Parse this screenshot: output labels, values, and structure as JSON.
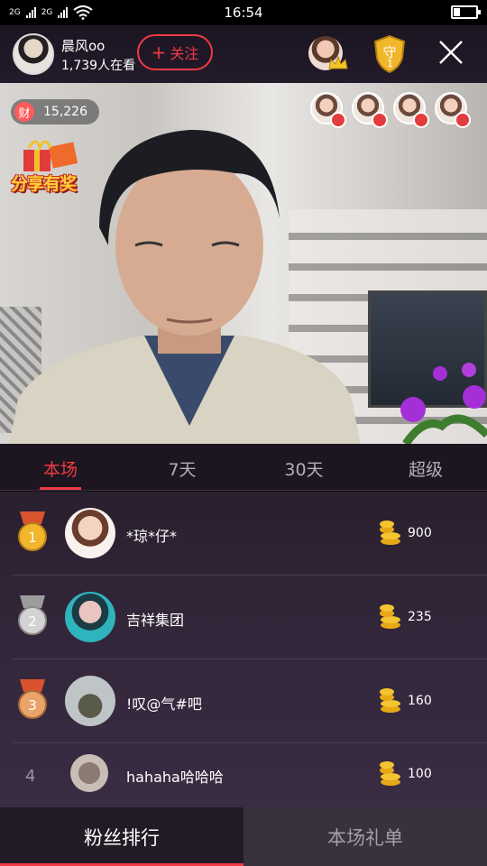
{
  "status_bar": {
    "signal1_label": "2G",
    "signal2_label": "2G",
    "time": "16:54",
    "battery_level": 0.3
  },
  "header": {
    "host_name": "晨风oo",
    "viewer_count": "1,739人在看",
    "follow_plus": "+",
    "follow_label": "关注",
    "guard_count": "1"
  },
  "video": {
    "coin_icon_label": "财",
    "coin_total": "15,226",
    "gift_banner_text": "分享有奖"
  },
  "tabs": [
    {
      "label": "本场",
      "active": true
    },
    {
      "label": "7天",
      "active": false
    },
    {
      "label": "30天",
      "active": false
    },
    {
      "label": "超级",
      "active": false
    }
  ],
  "ranking": [
    {
      "rank": "1",
      "medal": "gold",
      "name": "*琼*仔*",
      "amount": "900"
    },
    {
      "rank": "2",
      "medal": "silver",
      "name": "吉祥集团",
      "amount": "235"
    },
    {
      "rank": "3",
      "medal": "bronze",
      "name": "!叹@气#吧",
      "amount": "160"
    },
    {
      "rank": "4",
      "medal": "none",
      "name": "hahaha哈哈哈",
      "amount": "100"
    }
  ],
  "bottom_tabs": {
    "left_label": "粉丝排行",
    "right_label": "本场礼单"
  },
  "colors": {
    "accent": "#ef3b44",
    "background": "#2a1f2e"
  }
}
